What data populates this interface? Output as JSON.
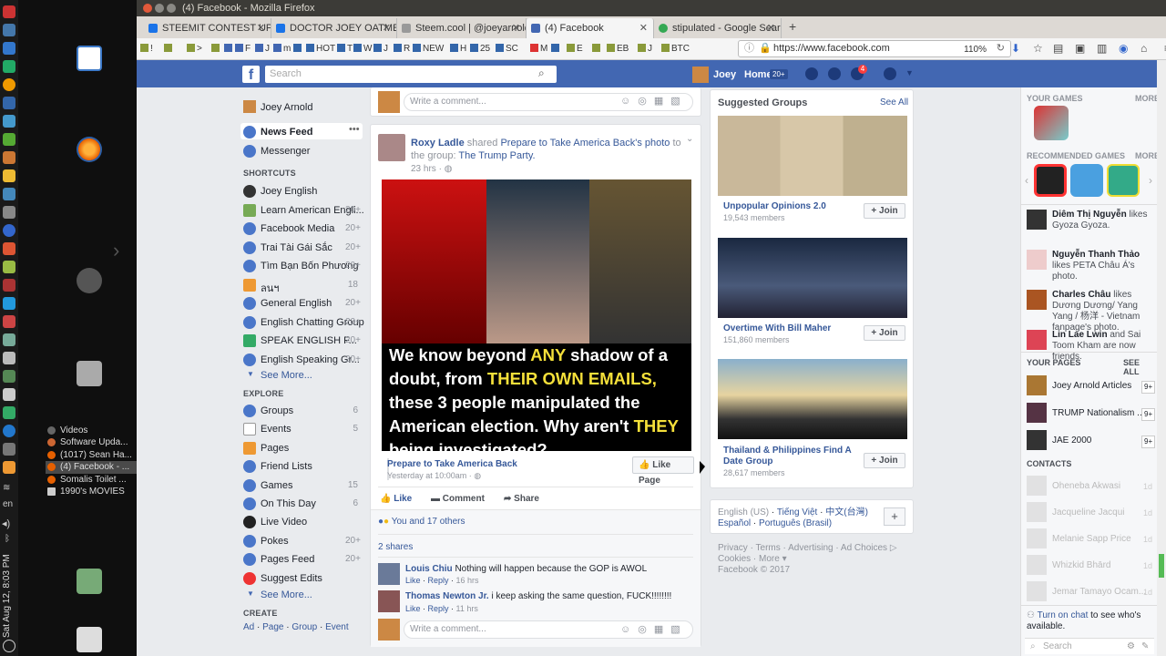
{
  "window": {
    "title": "(4) Facebook - Mozilla Firefox"
  },
  "tabs": [
    {
      "label": "STEEMIT CONTEST UP",
      "fav": "#1a73e8"
    },
    {
      "label": "DOCTOR JOEY OATMEAL",
      "fav": "#1a73e8"
    },
    {
      "label": "Steem.cool | @joeyarnold",
      "fav": "#888888"
    },
    {
      "label": "(4) Facebook",
      "fav": "#4267b2"
    },
    {
      "label": "stipulated - Google Search",
      "fav": "#34a853"
    }
  ],
  "bookmarks": [
    "!",
    "",
    ">",
    "",
    "",
    "F",
    "J",
    "m",
    "",
    "HOT",
    "T",
    "W",
    "J",
    "R",
    "NEW",
    "H",
    "25",
    "SC",
    "M",
    "",
    "E",
    "",
    "EB",
    "J",
    "BTC"
  ],
  "url": "https://www.facebook.com",
  "zoom": "110%",
  "desktop": {
    "list": [
      "Videos",
      "Software Upda...",
      "(1017) Sean Ha...",
      "(4) Facebook - ...",
      "Somalis Toilet ...",
      "1990's MOVIES"
    ],
    "clock": "Sat Aug 12, 8:03 PM",
    "lang": "en"
  },
  "fb_header": {
    "search_placeholder": "Search",
    "user": "Joey",
    "home": "Home",
    "home_count": "20+",
    "notif_count": "4"
  },
  "left_nav": {
    "profile": "Joey Arnold",
    "news_feed": "News Feed",
    "messenger": "Messenger",
    "shortcuts_title": "SHORTCUTS",
    "shortcuts": [
      {
        "label": "Joey English",
        "count": ""
      },
      {
        "label": "Learn American Engli...",
        "count": "20+"
      },
      {
        "label": "Facebook Media",
        "count": "20+"
      },
      {
        "label": "Trai Tài Gái Sắc",
        "count": "20+"
      },
      {
        "label": "Tìm Bạn Bốn Phương",
        "count": "20+"
      },
      {
        "label": "ลนฯ",
        "count": "18"
      },
      {
        "label": "General English",
        "count": "20+"
      },
      {
        "label": "English Chatting Group",
        "count": "20+"
      },
      {
        "label": "SPEAK ENGLISH F...",
        "count": "20+"
      },
      {
        "label": "English Speaking Gr...",
        "count": "20+"
      }
    ],
    "see_more": "See More...",
    "explore_title": "EXPLORE",
    "explore": [
      {
        "label": "Groups",
        "count": "6"
      },
      {
        "label": "Events",
        "count": "5"
      },
      {
        "label": "Pages",
        "count": ""
      },
      {
        "label": "Friend Lists",
        "count": ""
      },
      {
        "label": "Games",
        "count": "15"
      },
      {
        "label": "On This Day",
        "count": "6"
      },
      {
        "label": "Live Video",
        "count": ""
      },
      {
        "label": "Pokes",
        "count": "20+"
      },
      {
        "label": "Pages Feed",
        "count": "20+"
      },
      {
        "label": "Suggest Edits",
        "count": ""
      }
    ],
    "see_more2": "See More...",
    "create_title": "CREATE",
    "create": [
      "Ad",
      "Page",
      "Group",
      "Event"
    ]
  },
  "post": {
    "comment_placeholder": "Write a comment...",
    "author": "Roxy Ladle",
    "shared_text": "shared",
    "shared_page": "Prepare to Take America Back",
    "shared_obj": "'s photo",
    "to_text": "to the group:",
    "group": "The Trump Party.",
    "time": "23 hrs",
    "image_text": [
      "We know beyond ",
      "ANY",
      " shadow of a doubt, from ",
      "THEIR OWN EMAILS,",
      " these 3 people manipulated the American election. Why aren't ",
      "THEY",
      " being investigated?"
    ],
    "page_name": "Prepare to Take America Back",
    "page_time": "Yesterday at 10:00am",
    "like_page": "Like Page",
    "actions": {
      "like": "Like",
      "comment": "Comment",
      "share": "Share"
    },
    "reactions": "You and 17 others",
    "shares": "2 shares",
    "comments": [
      {
        "name": "Louis Chiu",
        "text": "Nothing will happen because the GOP is AWOL",
        "time": "16 hrs"
      },
      {
        "name": "Thomas Newton Jr.",
        "text": "i keep asking the same question, FUCK!!!!!!!!",
        "time": "11 hrs"
      }
    ],
    "like_label": "Like",
    "reply_label": "Reply"
  },
  "suggested": {
    "title": "Suggested Groups",
    "see_all": "See All",
    "groups": [
      {
        "name": "Unpopular Opinions 2.0",
        "members": "19,543 members"
      },
      {
        "name": "Overtime With Bill Maher",
        "members": "151,860 members"
      },
      {
        "name": "Thailand & Philippines Find A Date Group",
        "members": "28,617 members"
      }
    ],
    "join": "Join"
  },
  "languages": {
    "current": "English (US)",
    "others": [
      "Tiếng Việt",
      "中文(台灣)",
      "Español",
      "Português (Brasil)"
    ]
  },
  "footer_links": [
    "Privacy",
    "Terms",
    "Advertising",
    "Ad Choices",
    "Cookies",
    "More"
  ],
  "copyright": "Facebook © 2017",
  "far_right": {
    "your_games": "YOUR GAMES",
    "more": "MORE",
    "recommended": "RECOMMENDED GAMES",
    "ticker": [
      {
        "name": "Diêm Thị Nguyễn",
        "text": "likes Gyoza Gyoza."
      },
      {
        "name": "Nguyễn Thanh Thảo",
        "text": "likes PETA Châu Á's photo."
      },
      {
        "name": "Charles Châu",
        "text": "likes Dương Dương/ Yang Yang / 杨洋 - Vietnam fanpage's photo."
      },
      {
        "name": "Lin Lae Lwin",
        "text": "and Sai Toom Kham are now friends."
      }
    ],
    "your_pages": "YOUR PAGES",
    "see_all": "SEE ALL",
    "pages": [
      {
        "name": "Joey Arnold Articles",
        "badge": "9+"
      },
      {
        "name": "TRUMP Nationalism ...",
        "badge": "9+"
      },
      {
        "name": "JAE 2000",
        "badge": "9+"
      }
    ],
    "contacts": "CONTACTS",
    "contact_list": [
      {
        "name": "Oheneba Akwasi",
        "time": "1d"
      },
      {
        "name": "Jacqueline Jacqui",
        "time": "1d"
      },
      {
        "name": "Melanie Sapp Price",
        "time": "1d"
      },
      {
        "name": "Whizkid Bhārd",
        "time": "1d"
      },
      {
        "name": "Jemar Tamayo Ocam...",
        "time": "1d"
      }
    ],
    "turn_on_chat": "Turn on chat",
    "chat_rest": "to see who's available.",
    "search": "Search"
  }
}
